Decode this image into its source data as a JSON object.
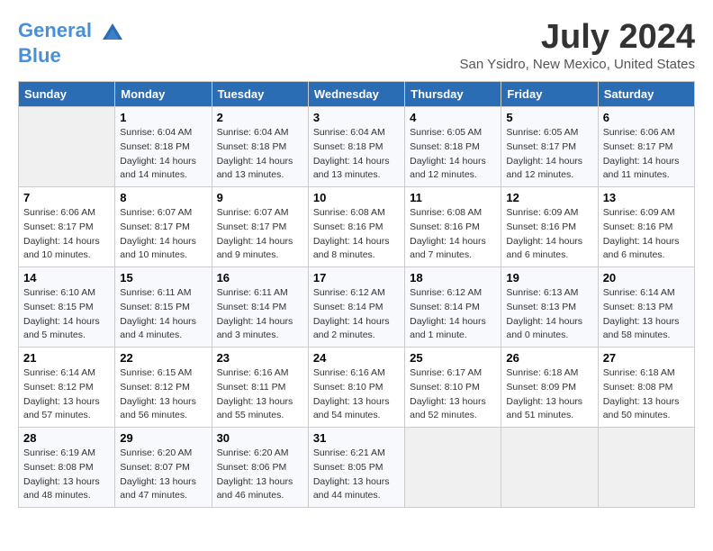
{
  "header": {
    "logo_line1": "General",
    "logo_line2": "Blue",
    "month": "July 2024",
    "location": "San Ysidro, New Mexico, United States"
  },
  "columns": [
    "Sunday",
    "Monday",
    "Tuesday",
    "Wednesday",
    "Thursday",
    "Friday",
    "Saturday"
  ],
  "weeks": [
    [
      {
        "day": "",
        "info": ""
      },
      {
        "day": "1",
        "info": "Sunrise: 6:04 AM\nSunset: 8:18 PM\nDaylight: 14 hours\nand 14 minutes."
      },
      {
        "day": "2",
        "info": "Sunrise: 6:04 AM\nSunset: 8:18 PM\nDaylight: 14 hours\nand 13 minutes."
      },
      {
        "day": "3",
        "info": "Sunrise: 6:04 AM\nSunset: 8:18 PM\nDaylight: 14 hours\nand 13 minutes."
      },
      {
        "day": "4",
        "info": "Sunrise: 6:05 AM\nSunset: 8:18 PM\nDaylight: 14 hours\nand 12 minutes."
      },
      {
        "day": "5",
        "info": "Sunrise: 6:05 AM\nSunset: 8:17 PM\nDaylight: 14 hours\nand 12 minutes."
      },
      {
        "day": "6",
        "info": "Sunrise: 6:06 AM\nSunset: 8:17 PM\nDaylight: 14 hours\nand 11 minutes."
      }
    ],
    [
      {
        "day": "7",
        "info": "Sunrise: 6:06 AM\nSunset: 8:17 PM\nDaylight: 14 hours\nand 10 minutes."
      },
      {
        "day": "8",
        "info": "Sunrise: 6:07 AM\nSunset: 8:17 PM\nDaylight: 14 hours\nand 10 minutes."
      },
      {
        "day": "9",
        "info": "Sunrise: 6:07 AM\nSunset: 8:17 PM\nDaylight: 14 hours\nand 9 minutes."
      },
      {
        "day": "10",
        "info": "Sunrise: 6:08 AM\nSunset: 8:16 PM\nDaylight: 14 hours\nand 8 minutes."
      },
      {
        "day": "11",
        "info": "Sunrise: 6:08 AM\nSunset: 8:16 PM\nDaylight: 14 hours\nand 7 minutes."
      },
      {
        "day": "12",
        "info": "Sunrise: 6:09 AM\nSunset: 8:16 PM\nDaylight: 14 hours\nand 6 minutes."
      },
      {
        "day": "13",
        "info": "Sunrise: 6:09 AM\nSunset: 8:16 PM\nDaylight: 14 hours\nand 6 minutes."
      }
    ],
    [
      {
        "day": "14",
        "info": "Sunrise: 6:10 AM\nSunset: 8:15 PM\nDaylight: 14 hours\nand 5 minutes."
      },
      {
        "day": "15",
        "info": "Sunrise: 6:11 AM\nSunset: 8:15 PM\nDaylight: 14 hours\nand 4 minutes."
      },
      {
        "day": "16",
        "info": "Sunrise: 6:11 AM\nSunset: 8:14 PM\nDaylight: 14 hours\nand 3 minutes."
      },
      {
        "day": "17",
        "info": "Sunrise: 6:12 AM\nSunset: 8:14 PM\nDaylight: 14 hours\nand 2 minutes."
      },
      {
        "day": "18",
        "info": "Sunrise: 6:12 AM\nSunset: 8:14 PM\nDaylight: 14 hours\nand 1 minute."
      },
      {
        "day": "19",
        "info": "Sunrise: 6:13 AM\nSunset: 8:13 PM\nDaylight: 14 hours\nand 0 minutes."
      },
      {
        "day": "20",
        "info": "Sunrise: 6:14 AM\nSunset: 8:13 PM\nDaylight: 13 hours\nand 58 minutes."
      }
    ],
    [
      {
        "day": "21",
        "info": "Sunrise: 6:14 AM\nSunset: 8:12 PM\nDaylight: 13 hours\nand 57 minutes."
      },
      {
        "day": "22",
        "info": "Sunrise: 6:15 AM\nSunset: 8:12 PM\nDaylight: 13 hours\nand 56 minutes."
      },
      {
        "day": "23",
        "info": "Sunrise: 6:16 AM\nSunset: 8:11 PM\nDaylight: 13 hours\nand 55 minutes."
      },
      {
        "day": "24",
        "info": "Sunrise: 6:16 AM\nSunset: 8:10 PM\nDaylight: 13 hours\nand 54 minutes."
      },
      {
        "day": "25",
        "info": "Sunrise: 6:17 AM\nSunset: 8:10 PM\nDaylight: 13 hours\nand 52 minutes."
      },
      {
        "day": "26",
        "info": "Sunrise: 6:18 AM\nSunset: 8:09 PM\nDaylight: 13 hours\nand 51 minutes."
      },
      {
        "day": "27",
        "info": "Sunrise: 6:18 AM\nSunset: 8:08 PM\nDaylight: 13 hours\nand 50 minutes."
      }
    ],
    [
      {
        "day": "28",
        "info": "Sunrise: 6:19 AM\nSunset: 8:08 PM\nDaylight: 13 hours\nand 48 minutes."
      },
      {
        "day": "29",
        "info": "Sunrise: 6:20 AM\nSunset: 8:07 PM\nDaylight: 13 hours\nand 47 minutes."
      },
      {
        "day": "30",
        "info": "Sunrise: 6:20 AM\nSunset: 8:06 PM\nDaylight: 13 hours\nand 46 minutes."
      },
      {
        "day": "31",
        "info": "Sunrise: 6:21 AM\nSunset: 8:05 PM\nDaylight: 13 hours\nand 44 minutes."
      },
      {
        "day": "",
        "info": ""
      },
      {
        "day": "",
        "info": ""
      },
      {
        "day": "",
        "info": ""
      }
    ]
  ]
}
